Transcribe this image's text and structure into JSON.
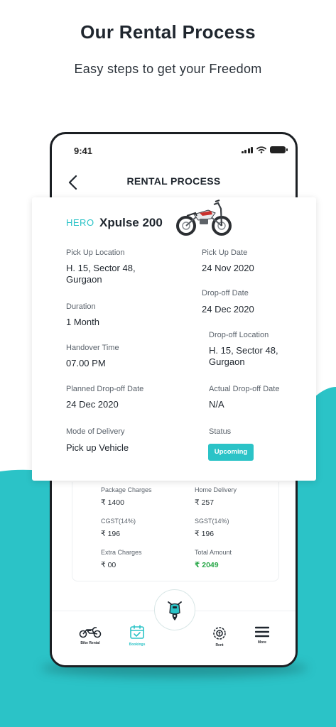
{
  "page": {
    "heading": "Our Rental Process",
    "subheading": "Easy steps to get your Freedom",
    "accent_color": "#2bc3c7"
  },
  "status_bar": {
    "time": "9:41",
    "icons": [
      "signal-icon",
      "wifi-icon",
      "battery-icon"
    ]
  },
  "app_bar": {
    "title": "RENTAL PROCESS",
    "back_icon": "chevron-left-icon"
  },
  "booking": {
    "brand": "HERO",
    "model": "Xpulse 200",
    "pickup_location_label": "Pick Up Location",
    "pickup_location": "H. 15, Sector 48, Gurgaon",
    "pickup_date_label": "Pick Up Date",
    "pickup_date": "24 Nov 2020",
    "dropoff_date_label": "Drop-off  Date",
    "dropoff_date": "24 Dec 2020",
    "duration_label": "Duration",
    "duration": "1 Month",
    "dropoff_location_label": "Drop-off Location",
    "dropoff_location": "H. 15, Sector 48, Gurgaon",
    "handover_time_label": "Handover Time",
    "handover_time": "07.00 PM",
    "planned_dropoff_label": "Planned Drop-off Date",
    "planned_dropoff": "24 Dec 2020",
    "actual_dropoff_label": "Actual Drop-off Date",
    "actual_dropoff": "N/A",
    "delivery_mode_label": "Mode of Delivery",
    "delivery_mode": "Pick up Vehicle",
    "status_label": "Status",
    "status": "Upcoming"
  },
  "charges": {
    "package_label": "Package Charges",
    "package_value": "₹ 1400",
    "home_delivery_label": "Home Delivery",
    "home_delivery_value": "₹ 257",
    "cgst_label": "CGST(14%)",
    "cgst_value": "₹ 196",
    "sgst_label": "SGST(14%)",
    "sgst_value": "₹ 196",
    "extra_label": "Extra Charges",
    "extra_value": "₹ 00",
    "total_label": "Total Amount",
    "total_value": "₹ 2049"
  },
  "bottom_nav": {
    "items": [
      {
        "label": "Bike Rental",
        "icon": "motorcycle-icon"
      },
      {
        "label": "Bookings",
        "icon": "calendar-check-icon",
        "active": true
      },
      {
        "label": "Rent",
        "icon": "rent-gear-icon"
      },
      {
        "label": "More",
        "icon": "menu-icon"
      }
    ],
    "fab_icon": "scooter-location-icon"
  }
}
